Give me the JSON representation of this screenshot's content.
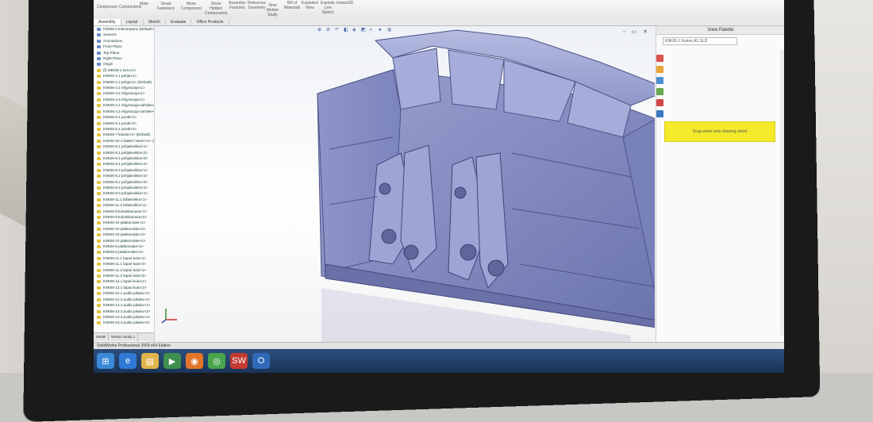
{
  "ribbon": {
    "groups": [
      {
        "id": "assembly-component",
        "label": "Component"
      },
      {
        "id": "assembly-components",
        "label": "Components"
      },
      {
        "id": "mate",
        "label": "Mate"
      },
      {
        "id": "smart-fasteners",
        "label": "Smart\nFasteners"
      },
      {
        "id": "move-component",
        "label": "Move\nComponent"
      },
      {
        "id": "show-hidden",
        "label": "Show\nHidden\nComponents"
      },
      {
        "id": "assembly-features",
        "label": "Assembly\nFeatures"
      },
      {
        "id": "reference-geometry",
        "label": "Reference\nGeometry"
      },
      {
        "id": "new-motion-study",
        "label": "New\nMotion\nStudy"
      },
      {
        "id": "bill-of-materials",
        "label": "Bill of\nMaterials"
      },
      {
        "id": "exploded-view",
        "label": "Exploded\nView"
      },
      {
        "id": "explode-line-sketch",
        "label": "Explode\nLine\nSketch"
      },
      {
        "id": "instant3d",
        "label": "Instant3D"
      }
    ],
    "tabs": [
      "Assembly",
      "Layout",
      "Sketch",
      "Evaluate",
      "Office Products"
    ]
  },
  "tree": {
    "items": [
      "K9K06-1 kokoonpano (Default<Disp",
      "Sensors",
      "Annotations",
      "Front Plane",
      "Top Plane",
      "Right Plane",
      "Origin",
      "(f) K9K06-1 kuru<1>",
      "K9K06-1.1 pohja<1>",
      "K9K06-1.2 pohja<1> (Default)",
      "K9K06-4.1 ehjyssuoja<1>",
      "K9K06-4.2 ehjyssuoja<1>",
      "K9K06-4.3 ehjyssuoja<1>",
      "K9K06-4.1 ehjyssuoja-vahvike<1>",
      "K9K06-4.2 ehjyssuoja-vahvike<1>",
      "K9K06-5.1 pootti<1>",
      "K9K06-5.1 pootti<2>",
      "K9K06-5.1 pootti<3>",
      "K9K06-7 kulutin<1> (Default)",
      "K9K06-10.1 lisäteri Vasen<1> (Def",
      "K9K06-8.1 pohjalevikko<1>",
      "K9K06-8.1 pohjalevikko<2>",
      "K9K06-8.1 pohjalevikko<3>",
      "K9K06-8.1 pohjalevikko<4>",
      "K9K06-8.2 pohjalevikko<1>",
      "K9K06-8.2 pohjalevikko<2>",
      "K9K06-8.2 pohjalevikko<3>",
      "K9K06-8.2 pohjalevikko<4>",
      "K9K06-8.3 pohjalevikko<1>",
      "K9K06-11.1 kiilalevikko<1>",
      "K9K06-11.2 kiilalevikko<1>",
      "K9K06-9 kulutinkanava<1>",
      "K9K06-9 kulutinkanava<2>",
      "K9K06-10 pääkorvake<1>",
      "K9K06-10 pääkorvake<2>",
      "K9K06-10 pääkorvake<3>",
      "K9K06-10 pääkorvake<4>",
      "K9K06-8 pääkorvake<1>",
      "K9K06-8 pääkorvake<2>",
      "K9K06-11.1 lapari kulu<1>",
      "K9K06-11.1 lapari kulu<2>",
      "K9K06-11.2 lapari kulu<1>",
      "K9K06-11.2 lapari kulu<2>",
      "K9K06-12.1 lapari kulu<1>",
      "K9K06-12.1 lapari kulu<2>",
      "K9K06-12.1 pudla pikaku<1>",
      "K9K06-12.2 pudla pikaku<1>",
      "K9K06-13.1 pudla pikaku<1>",
      "K9K06-13.2 pudla pikaku<2>",
      "K9K06-13.3 pudla pikaku<1>",
      "K9K06-13.3 pudla pikaku<2>"
    ],
    "bottom_tabs": [
      "Model",
      "Motion Study 1"
    ]
  },
  "viewport": {
    "window_controls": "▫ ▭ ✕"
  },
  "view_palette": {
    "title": "View Palette",
    "combo_value": "K9K06-1 Kokoo A1.SLD",
    "note": "Drag views onto drawing sheet",
    "icon_colors": [
      "#d9534f",
      "#e8a33b",
      "#4c8fd1",
      "#6aa84f",
      "#d04949",
      "#3b78c4"
    ]
  },
  "status": {
    "text": "SolidWorks Professional 2009 x64 Edition"
  },
  "taskbar": {
    "items": [
      {
        "name": "start",
        "glyph": "⊞",
        "color": "#3b8ad9"
      },
      {
        "name": "ie",
        "glyph": "e",
        "color": "#2f7ad6"
      },
      {
        "name": "explorer",
        "glyph": "▤",
        "color": "#e1b54a"
      },
      {
        "name": "media",
        "glyph": "▶",
        "color": "#3f8f4f"
      },
      {
        "name": "firefox",
        "glyph": "◉",
        "color": "#e2752b"
      },
      {
        "name": "chrome",
        "glyph": "◎",
        "color": "#4aa54d"
      },
      {
        "name": "solidworks",
        "glyph": "SW",
        "color": "#c23a32"
      },
      {
        "name": "outlook",
        "glyph": "O",
        "color": "#2f6ab8"
      }
    ]
  }
}
